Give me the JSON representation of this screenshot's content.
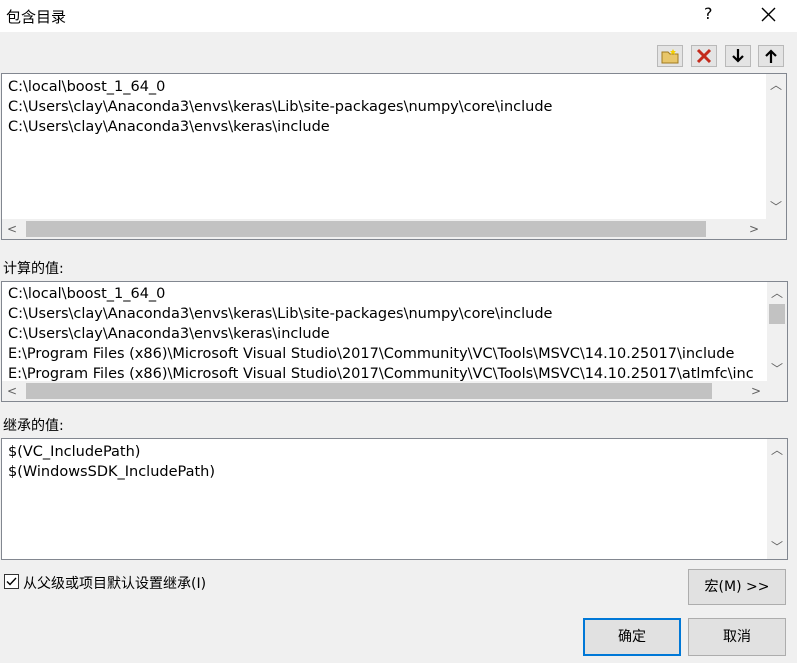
{
  "dialog": {
    "title": "包含目录",
    "help_label": "?"
  },
  "toolbar": {
    "icons": [
      "new-folder-icon",
      "delete-icon",
      "move-down-icon",
      "move-up-icon"
    ],
    "delete_color": "#c42b1c"
  },
  "editable_list": {
    "lines": [
      "C:\\local\\boost_1_64_0",
      "C:\\Users\\clay\\Anaconda3\\envs\\keras\\Lib\\site-packages\\numpy\\core\\include",
      "C:\\Users\\clay\\Anaconda3\\envs\\keras\\include"
    ]
  },
  "evaluated": {
    "label": "计算的值:",
    "lines": [
      "C:\\local\\boost_1_64_0",
      "C:\\Users\\clay\\Anaconda3\\envs\\keras\\Lib\\site-packages\\numpy\\core\\include",
      "C:\\Users\\clay\\Anaconda3\\envs\\keras\\include",
      "E:\\Program Files (x86)\\Microsoft Visual Studio\\2017\\Community\\VC\\Tools\\MSVC\\14.10.25017\\include",
      "E:\\Program Files (x86)\\Microsoft Visual Studio\\2017\\Community\\VC\\Tools\\MSVC\\14.10.25017\\atlmfc\\inc"
    ]
  },
  "inherited": {
    "label": "继承的值:",
    "lines": [
      "$(VC_IncludePath)",
      "$(WindowsSDK_IncludePath)"
    ]
  },
  "inherit_checkbox": {
    "checked": true,
    "label": "从父级或项目默认设置继承(I)"
  },
  "buttons": {
    "macros": "宏(M) >>",
    "ok": "确定",
    "cancel": "取消"
  },
  "colors": {
    "accent": "#0078d7"
  }
}
